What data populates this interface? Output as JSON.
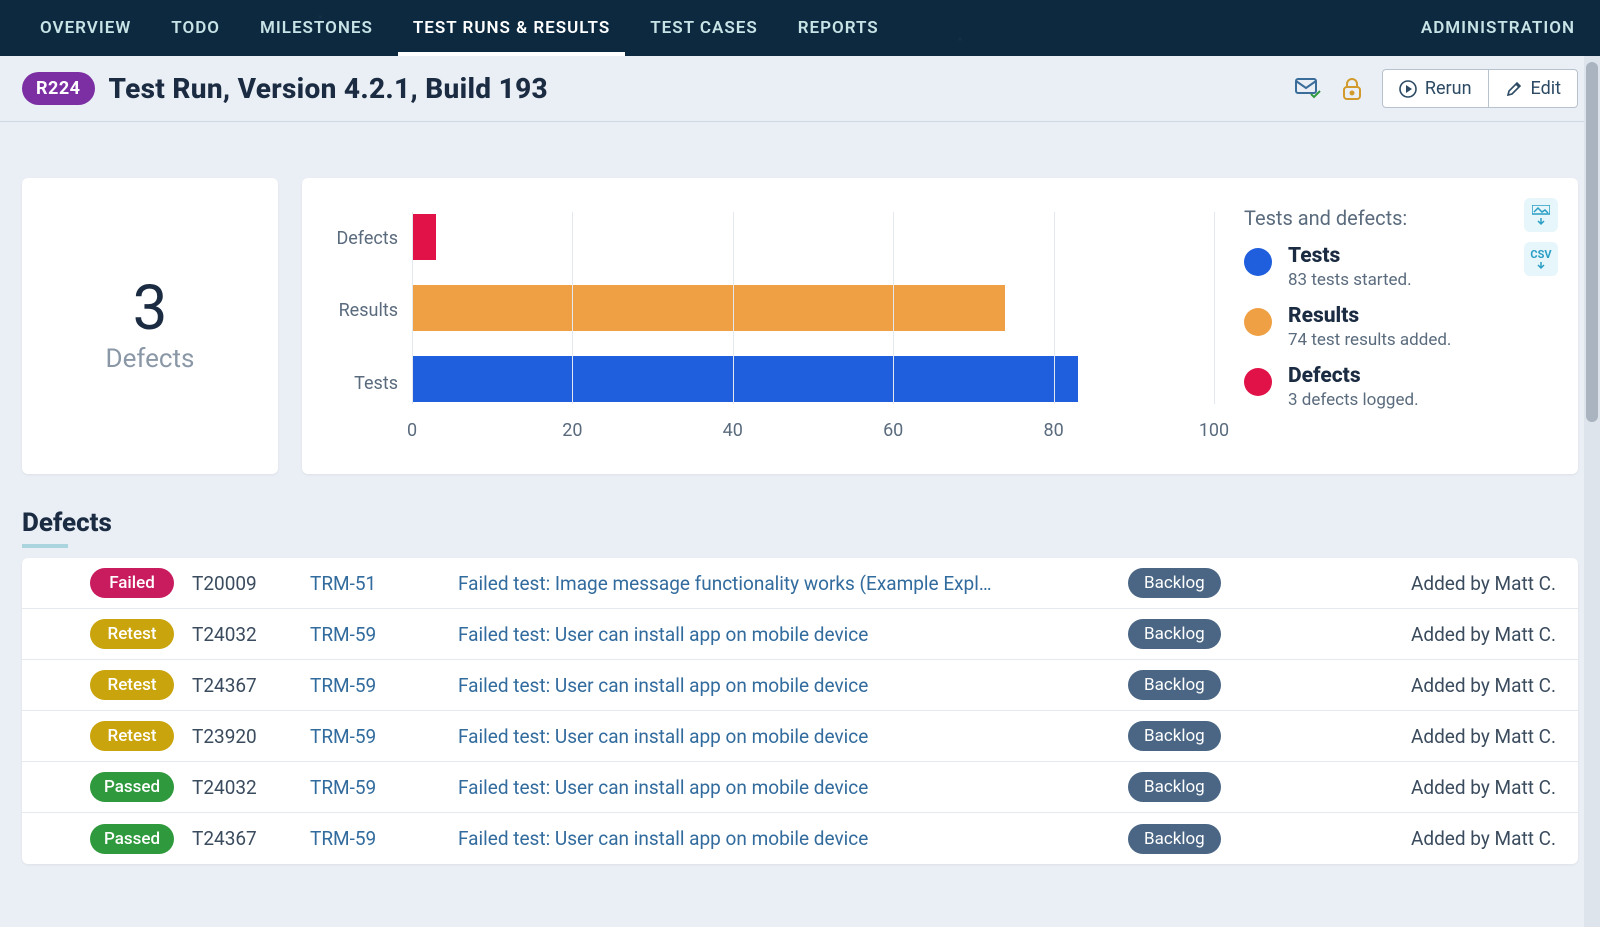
{
  "nav": {
    "items": [
      "OVERVIEW",
      "TODO",
      "MILESTONES",
      "TEST RUNS & RESULTS",
      "TEST CASES",
      "REPORTS"
    ],
    "activeIndex": 3,
    "admin": "ADMINISTRATION"
  },
  "header": {
    "badge": "R224",
    "title": "Test Run, Version 4.2.1, Build 193",
    "rerun": "Rerun",
    "edit": "Edit"
  },
  "summary": {
    "defect_count": "3",
    "defect_label": "Defects"
  },
  "chart_data": {
    "type": "bar",
    "orientation": "horizontal",
    "categories": [
      "Defects",
      "Results",
      "Tests"
    ],
    "values": [
      3,
      74,
      83
    ],
    "colors": [
      "#e11247",
      "#f0a044",
      "#1f5edc"
    ],
    "xlabel": "",
    "ylabel": "",
    "xlim": [
      0,
      100
    ],
    "xticks": [
      0,
      20,
      40,
      60,
      80,
      100
    ],
    "title": ""
  },
  "legend": {
    "title": "Tests and defects:",
    "items": [
      {
        "key": "tests",
        "name": "Tests",
        "desc": "83 tests started."
      },
      {
        "key": "results",
        "name": "Results",
        "desc": "74 test results added."
      },
      {
        "key": "defects",
        "name": "Defects",
        "desc": "3 defects logged."
      }
    ],
    "export_csv": "CSV"
  },
  "defects": {
    "section_title": "Defects",
    "rows": [
      {
        "status": "Failed",
        "status_class": "failed",
        "test": "T20009",
        "link": "TRM-51",
        "title": "Failed test: Image message functionality works (Example Expl…",
        "state": "Backlog",
        "added": "Added by Matt C."
      },
      {
        "status": "Retest",
        "status_class": "retest",
        "test": "T24032",
        "link": "TRM-59",
        "title": "Failed test: User can install app on mobile device",
        "state": "Backlog",
        "added": "Added by Matt C."
      },
      {
        "status": "Retest",
        "status_class": "retest",
        "test": "T24367",
        "link": "TRM-59",
        "title": "Failed test: User can install app on mobile device",
        "state": "Backlog",
        "added": "Added by Matt C."
      },
      {
        "status": "Retest",
        "status_class": "retest",
        "test": "T23920",
        "link": "TRM-59",
        "title": "Failed test: User can install app on mobile device",
        "state": "Backlog",
        "added": "Added by Matt C."
      },
      {
        "status": "Passed",
        "status_class": "passed",
        "test": "T24032",
        "link": "TRM-59",
        "title": "Failed test: User can install app on mobile device",
        "state": "Backlog",
        "added": "Added by Matt C."
      },
      {
        "status": "Passed",
        "status_class": "passed",
        "test": "T24367",
        "link": "TRM-59",
        "title": "Failed test: User can install app on mobile device",
        "state": "Backlog",
        "added": "Added by Matt C."
      }
    ]
  }
}
